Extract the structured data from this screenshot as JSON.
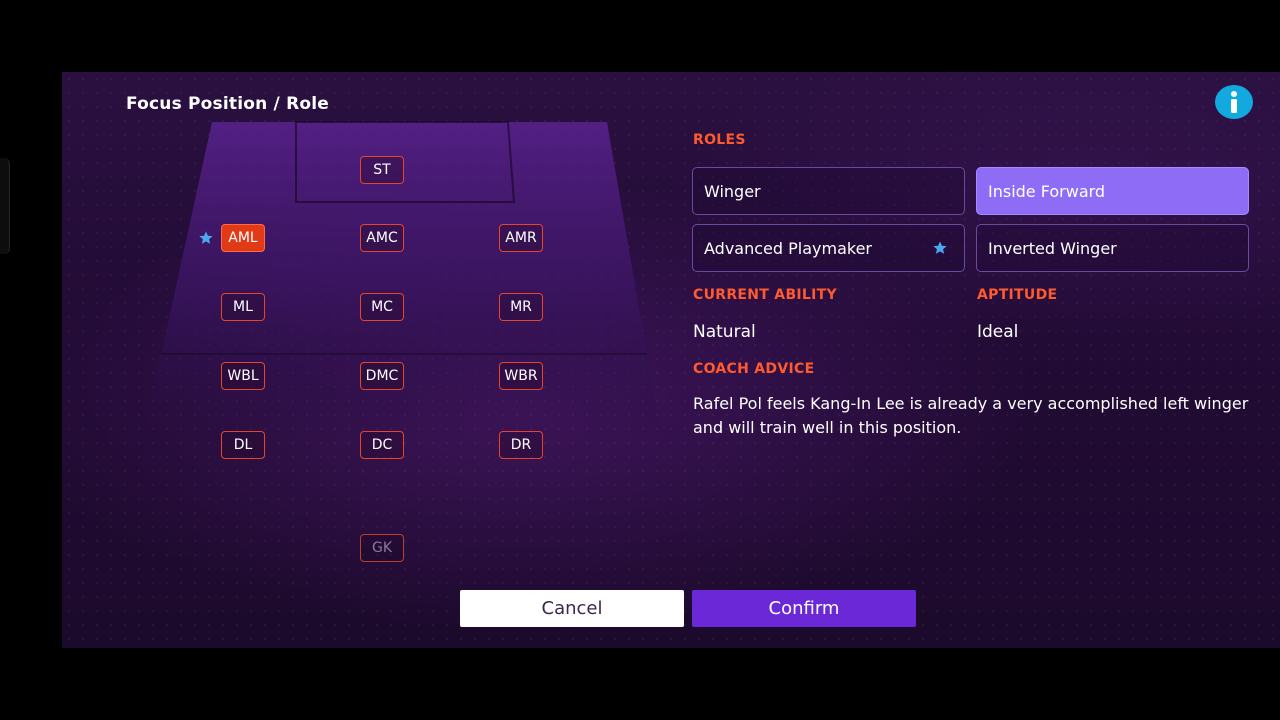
{
  "title": "Focus Position / Role",
  "positions": {
    "st": "ST",
    "aml": "AML",
    "amc": "AMC",
    "amr": "AMR",
    "ml": "ML",
    "mc": "MC",
    "mr": "MR",
    "wbl": "WBL",
    "dmc": "DMC",
    "wbr": "WBR",
    "dl": "DL",
    "dc": "DC",
    "dr": "DR",
    "gk": "GK"
  },
  "selected_position": "AML",
  "roles_heading": "ROLES",
  "roles": [
    {
      "label": "Winger",
      "selected": false,
      "starred": false
    },
    {
      "label": "Inside Forward",
      "selected": true,
      "starred": false
    },
    {
      "label": "Advanced Playmaker",
      "selected": false,
      "starred": true
    },
    {
      "label": "Inverted Winger",
      "selected": false,
      "starred": false
    }
  ],
  "current_ability_heading": "CURRENT ABILITY",
  "current_ability_value": "Natural",
  "aptitude_heading": "APTITUDE",
  "aptitude_value": "Ideal",
  "coach_advice_heading": "COACH ADVICE",
  "coach_advice_text": "Rafel Pol feels Kang-In Lee is already a very accomplished left winger and will train well in this position.",
  "buttons": {
    "cancel": "Cancel",
    "confirm": "Confirm"
  },
  "colors": {
    "accent_orange": "#ff5a2e",
    "selected_position": "#e23a17",
    "selected_role": "#8f6cf5",
    "confirm": "#6a28d6",
    "info": "#12a9de",
    "star": "#4aa8f0"
  },
  "icons": {
    "info": "info-icon",
    "star": "star-icon"
  }
}
